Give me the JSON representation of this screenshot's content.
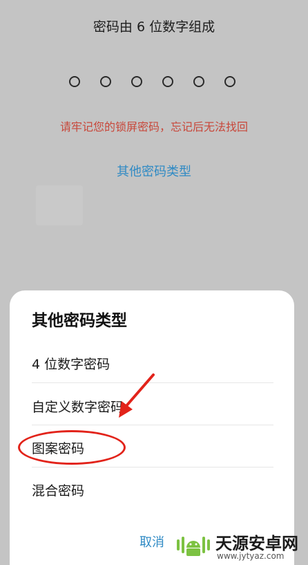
{
  "lock_screen": {
    "hint": "密码由 6 位数字组成",
    "pin_dots_count": 6,
    "warning": "请牢记您的锁屏密码，忘记后无法找回",
    "other_types_link": "其他密码类型"
  },
  "sheet": {
    "title": "其他密码类型",
    "options": [
      {
        "label": "4 位数字密码"
      },
      {
        "label": "自定义数字密码"
      },
      {
        "label": "图案密码"
      },
      {
        "label": "混合密码"
      }
    ],
    "cancel_label": "取消"
  },
  "annotation": {
    "highlight_color": "#e2231a",
    "arrow_icon": "red-arrow-icon"
  },
  "watermark": {
    "name": "天源安卓网",
    "url": "www.jytyaz.com"
  },
  "colors": {
    "accent": "#2f8ac4",
    "warning": "#c8473a",
    "backdrop": "#c4c4c4"
  }
}
